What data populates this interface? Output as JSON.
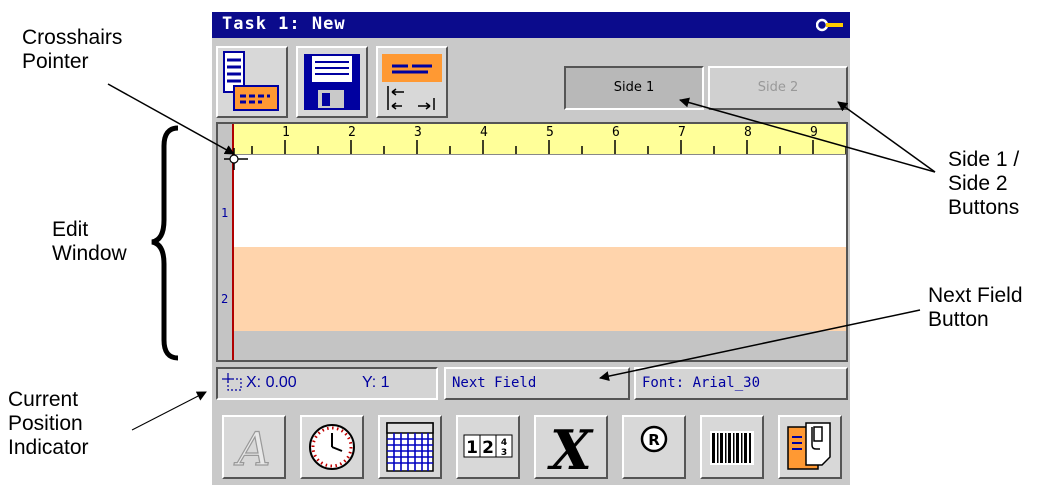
{
  "window": {
    "title": "Task 1: New"
  },
  "toolbar": {
    "side1_label": "Side 1",
    "side2_label": "Side 2"
  },
  "ruler": {
    "ticks": [
      "1",
      "2",
      "3",
      "4",
      "5",
      "6",
      "7",
      "8",
      "9"
    ]
  },
  "edit": {
    "row1_label": "1",
    "row2_label": "2"
  },
  "status": {
    "x_label": "X: 0.00",
    "y_label": "Y: 1",
    "next_field_label": "Next Field",
    "font_label": "Font: Arial_30"
  },
  "callouts": {
    "crosshairs_line1": "Crosshairs",
    "crosshairs_line2": "Pointer",
    "edit_line1": "Edit",
    "edit_line2": "Window",
    "current_line1": "Current",
    "current_line2": "Position",
    "current_line3": "Indicator",
    "side_line1": "Side 1 /",
    "side_line2": "Side 2",
    "side_line3": "Buttons",
    "next_line1": "Next Field",
    "next_line2": "Button"
  },
  "bottom_icons": [
    "text-style-icon",
    "clock-icon",
    "calendar-icon",
    "counter-icon",
    "script-icon",
    "registered-icon",
    "barcode-icon",
    "paste-icon"
  ],
  "colors": {
    "titlebar": "#0b0b8c",
    "ruler": "#ffff99",
    "row2": "#ffd4ac",
    "status_text": "#0000a0"
  }
}
